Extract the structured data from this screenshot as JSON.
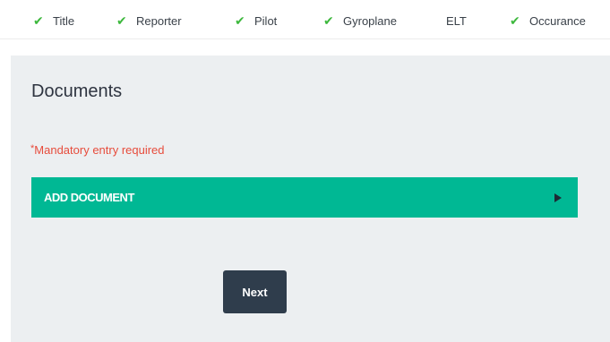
{
  "steps": [
    {
      "label": "Title",
      "completed": true
    },
    {
      "label": "Reporter",
      "completed": true
    },
    {
      "label": "Pilot",
      "completed": true
    },
    {
      "label": "Gyroplane",
      "completed": true
    },
    {
      "label": "ELT",
      "completed": false
    },
    {
      "label": "Occurance",
      "completed": true
    }
  ],
  "check_glyph": "✔",
  "section": {
    "title": "Documents",
    "mandatory_star": "*",
    "mandatory_text": "Mandatory entry required"
  },
  "add_document": {
    "label": "ADD DOCUMENT"
  },
  "next_label": "Next",
  "colors": {
    "check": "#3db83d",
    "accent": "#00b894",
    "mandatory": "#e74c3c",
    "button": "#2f3d4c",
    "panel": "#eceff1"
  }
}
